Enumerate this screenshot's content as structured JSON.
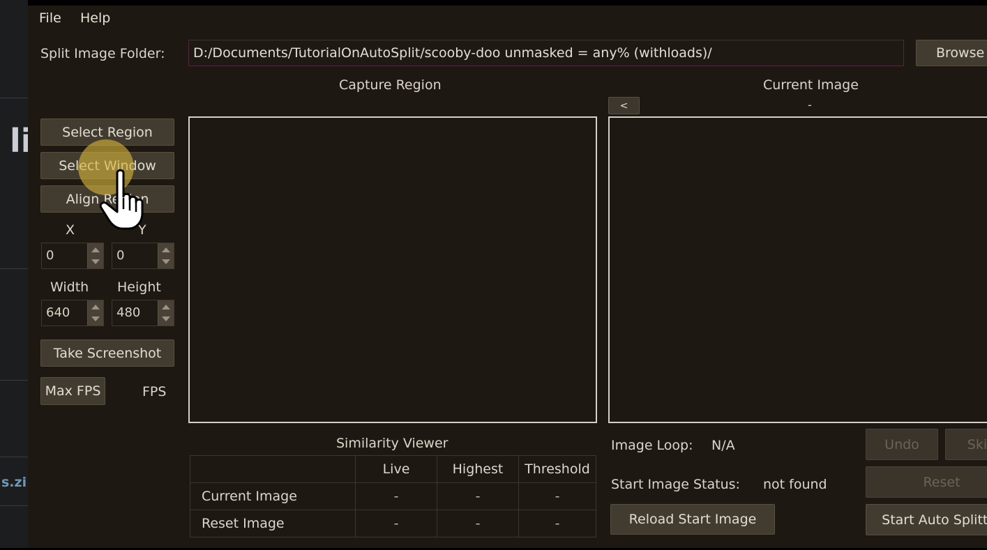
{
  "background_strip": {
    "fragments": [
      "li",
      "s.zi"
    ]
  },
  "menu": {
    "file": "File",
    "help": "Help"
  },
  "split_folder": {
    "label": "Split Image Folder:",
    "path": "D:/Documents/TutorialOnAutoSplit/scooby-doo unmasked = any% (withloads)/",
    "browse": "Browse"
  },
  "capture": {
    "title": "Capture Region",
    "select_region": "Select Region",
    "select_window": "Select Window",
    "align_region": "Align Region",
    "x_label": "X",
    "y_label": "Y",
    "x_value": "0",
    "y_value": "0",
    "width_label": "Width",
    "height_label": "Height",
    "width_value": "640",
    "height_value": "480",
    "take_screenshot": "Take Screenshot",
    "max_fps": "Max FPS",
    "fps_label": "FPS"
  },
  "current_image": {
    "title": "Current Image",
    "prev_button": "<",
    "name": "-"
  },
  "similarity": {
    "title": "Similarity Viewer",
    "columns": [
      "",
      "Live",
      "Highest",
      "Threshold"
    ],
    "rows": [
      {
        "label": "Current Image",
        "live": "-",
        "highest": "-",
        "threshold": "-"
      },
      {
        "label": "Reset Image",
        "live": "-",
        "highest": "-",
        "threshold": "-"
      }
    ]
  },
  "status": {
    "image_loop_label": "Image Loop:",
    "image_loop_value": "N/A",
    "start_status_label": "Start Image Status:",
    "start_status_value": "not found",
    "reload_start": "Reload Start Image"
  },
  "controls": {
    "undo": "Undo",
    "skip": "Skip",
    "reset": "Reset",
    "start_auto_splitter": "Start Auto Splitter"
  },
  "cursor": {
    "icon": "hand-pointer-icon",
    "highlight_color": "#d6b43c"
  }
}
